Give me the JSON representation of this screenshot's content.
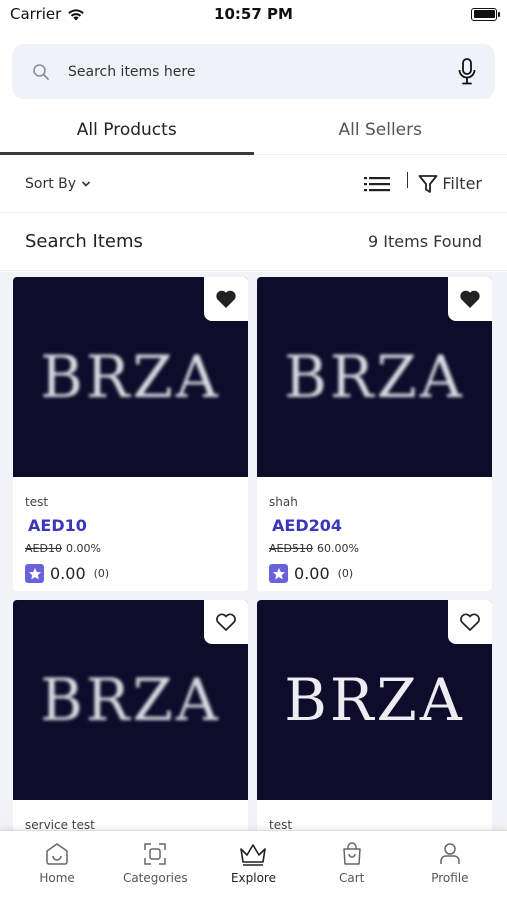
{
  "status": {
    "carrier": "Carrier",
    "time": "10:57 PM"
  },
  "search": {
    "placeholder": "Search items here"
  },
  "tabs": [
    {
      "label": "All Products",
      "active": true
    },
    {
      "label": "All Sellers",
      "active": false
    }
  ],
  "sort": {
    "label": "Sort By",
    "filter_label": "Filter"
  },
  "results": {
    "title": "Search Items",
    "count": "9 Items Found"
  },
  "products": [
    {
      "name": "test",
      "price": "AED10",
      "old_price": "AED10",
      "discount": "0.00%",
      "rating": "0.00",
      "reviews": "(0)",
      "favorited": true,
      "image_text": "BRZA"
    },
    {
      "name": "shah",
      "price": "AED204",
      "old_price": "AED510",
      "discount": "60.00%",
      "rating": "0.00",
      "reviews": "(0)",
      "favorited": true,
      "image_text": "BRZA"
    },
    {
      "name": "service test",
      "price": "",
      "old_price": "",
      "discount": "",
      "rating": "",
      "reviews": "",
      "favorited": false,
      "image_text": "BRZA"
    },
    {
      "name": "test",
      "price": "",
      "old_price": "",
      "discount": "",
      "rating": "",
      "reviews": "",
      "favorited": false,
      "image_text": "BRZA"
    }
  ],
  "nav": [
    {
      "label": "Home",
      "icon": "home-icon",
      "active": false
    },
    {
      "label": "Categories",
      "icon": "categories-icon",
      "active": false
    },
    {
      "label": "Explore",
      "icon": "crown-icon",
      "active": true
    },
    {
      "label": "Cart",
      "icon": "cart-icon",
      "active": false
    },
    {
      "label": "Profile",
      "icon": "profile-icon",
      "active": false
    }
  ],
  "colors": {
    "accent": "#3a37b8",
    "star": "#6a62d9",
    "image_bg": "#0d0d2b",
    "grid_bg": "#f2f3f8",
    "search_bg": "#eff2f8"
  }
}
